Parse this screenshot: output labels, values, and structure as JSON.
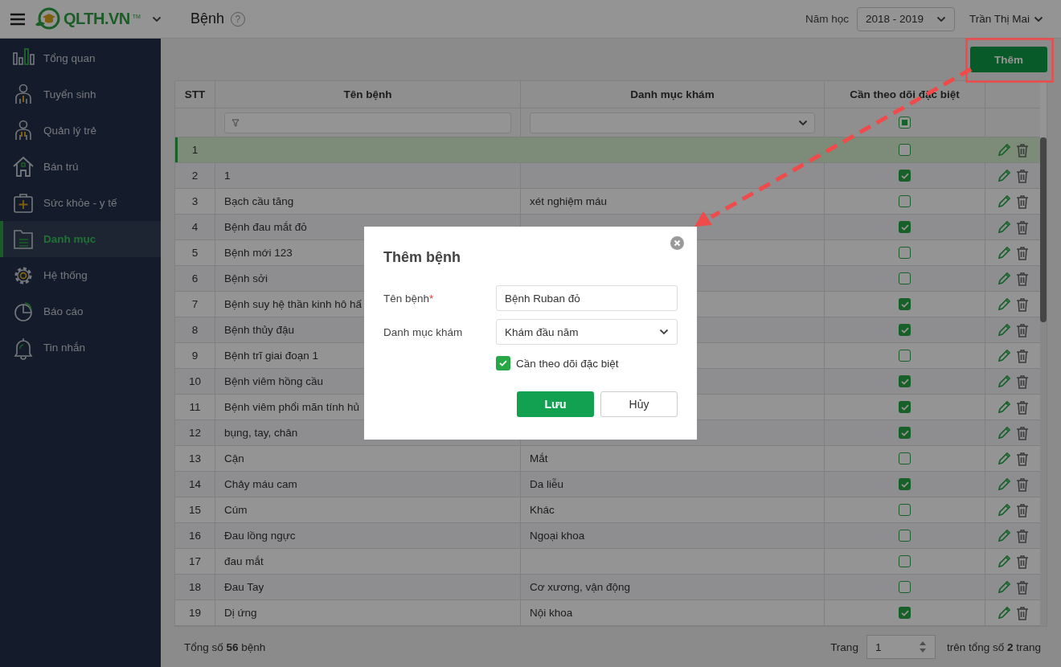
{
  "header": {
    "logo": {
      "text": "QLTH.VN",
      "mark": "TM"
    },
    "page_title": "Bệnh",
    "help": "?",
    "year_label": "Năm học",
    "year_value": "2018 - 2019",
    "user": "Trần Thị Mai"
  },
  "sidebar": {
    "items": [
      {
        "label": "Tổng quan",
        "selected": false
      },
      {
        "label": "Tuyển sinh",
        "selected": false
      },
      {
        "label": "Quản lý trẻ",
        "selected": false
      },
      {
        "label": "Bán trú",
        "selected": false
      },
      {
        "label": "Sức khỏe - y tế",
        "selected": false
      },
      {
        "label": "Danh mục",
        "selected": true
      },
      {
        "label": "Hệ thống",
        "selected": false
      },
      {
        "label": "Báo cáo",
        "selected": false
      },
      {
        "label": "Tin nhắn",
        "selected": false
      }
    ]
  },
  "toolbar": {
    "add_button": "Thêm"
  },
  "table": {
    "columns": [
      "STT",
      "Tên bệnh",
      "Danh mục khám",
      "Cần theo dõi đặc biệt"
    ],
    "filter": {
      "special_indeterminate": true
    },
    "rows": [
      {
        "stt": "1",
        "special": false,
        "selected": true
      },
      {
        "stt": "2",
        "name": "1",
        "special": true,
        "selected": false
      },
      {
        "stt": "3",
        "name": "Bạch cầu tăng",
        "category": "xét nghiệm máu",
        "special": false,
        "selected": false
      },
      {
        "stt": "4",
        "name": "Bệnh đau mắt đỏ",
        "special": true,
        "selected": false
      },
      {
        "stt": "5",
        "name": "Bệnh mới 123",
        "special": false,
        "selected": false
      },
      {
        "stt": "6",
        "name": "Bệnh sởi",
        "special": false,
        "selected": false
      },
      {
        "stt": "7",
        "name": "Bệnh suy hệ thần kinh hô hấ",
        "special": true,
        "selected": false
      },
      {
        "stt": "8",
        "name": "Bệnh thủy đậu",
        "special": true,
        "selected": false
      },
      {
        "stt": "9",
        "name": "Bệnh trĩ giai đoạn 1",
        "special": false,
        "selected": false
      },
      {
        "stt": "10",
        "name": "Bệnh viêm hồng cầu",
        "special": true,
        "selected": false
      },
      {
        "stt": "11",
        "name": "Bệnh viêm phổi mãn tính hủ",
        "special": true,
        "selected": false
      },
      {
        "stt": "12",
        "name": "bụng, tay, chân",
        "special": true,
        "selected": false
      },
      {
        "stt": "13",
        "name": "Cận",
        "category": "Mắt",
        "special": false,
        "selected": false
      },
      {
        "stt": "14",
        "name": "Chảy máu cam",
        "category": "Da liễu",
        "special": true,
        "selected": false
      },
      {
        "stt": "15",
        "name": "Cúm",
        "category": "Khác",
        "special": false,
        "selected": false
      },
      {
        "stt": "16",
        "name": "Đau lồng ngực",
        "category": "Ngoại khoa",
        "special": false,
        "selected": false
      },
      {
        "stt": "17",
        "name": "đau mắt",
        "special": false,
        "selected": false
      },
      {
        "stt": "18",
        "name": "Đau Tay",
        "category": "Cơ xương, vận động",
        "special": false,
        "selected": false
      },
      {
        "stt": "19",
        "name": "Dị ứng",
        "category": "Nội khoa",
        "special": true,
        "selected": false
      }
    ]
  },
  "footer": {
    "total": "Tổng số **56** bệnh",
    "page_label": "Trang",
    "page_value": "1",
    "page_total": "trên tổng số **2** trang"
  },
  "modal": {
    "title": "Thêm bệnh",
    "fields": [
      {
        "kind": "text",
        "label": "Tên bệnh",
        "required_mark": "*",
        "value": "Bệnh Ruban đỏ"
      },
      {
        "kind": "select",
        "label": "Danh mục khám",
        "value": "Khám đầu năm"
      }
    ],
    "checkbox": {
      "label": "Cần theo dõi đặc biệt",
      "checked": true
    },
    "buttons": [
      {
        "label": "Lưu",
        "kind": "primary"
      },
      {
        "label": "Hủy",
        "kind": "secondary"
      }
    ]
  }
}
